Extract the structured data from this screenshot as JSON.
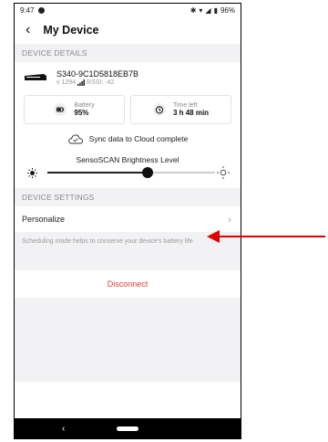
{
  "status_bar": {
    "time": "9:47",
    "battery": "96%"
  },
  "header": {
    "title": "My Device"
  },
  "device_details": {
    "section_label": "DEVICE DETAILS",
    "device_name": "S340-9C1D5818EB7B",
    "version": "v 1294",
    "rssi": "RSSI: -42",
    "battery": {
      "label": "Battery",
      "value": "95%"
    },
    "time_left": {
      "label": "Time left",
      "value": "3 h 48 min"
    },
    "sync_status": "Sync data to Cloud complete"
  },
  "brightness": {
    "label": "SensoSCAN Brightness Level",
    "level_fraction": 0.6
  },
  "device_settings": {
    "section_label": "DEVICE SETTINGS",
    "personalize_label": "Personalize",
    "note": "Scheduling mode helps to conserve your device's battery life"
  },
  "disconnect_label": "Disconnect",
  "colors": {
    "accent_red": "#e34040",
    "annotation_arrow": "#e00000"
  },
  "icons": [
    "back-icon",
    "battery-icon",
    "timer-icon",
    "cloud-check-icon",
    "sun-icon",
    "chevron-right-icon"
  ]
}
